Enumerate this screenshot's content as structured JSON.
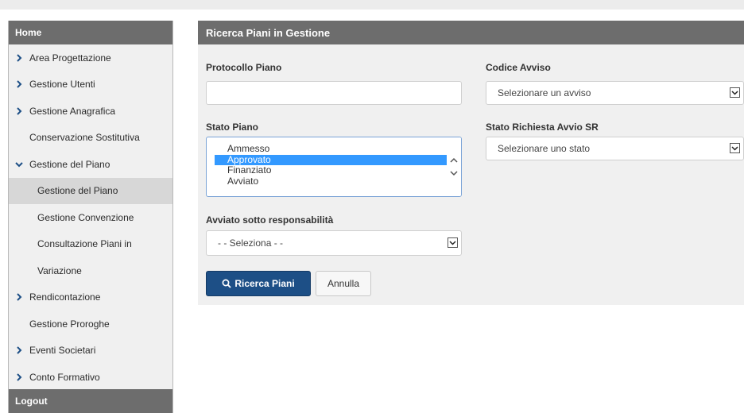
{
  "sidebar": {
    "home_label": "Home",
    "logout_label": "Logout",
    "items": [
      {
        "label": "Area Progettazione",
        "chevron": "right"
      },
      {
        "label": "Gestione Utenti",
        "chevron": "right"
      },
      {
        "label": "Gestione Anagrafica",
        "chevron": "right"
      },
      {
        "label": "Conservazione Sostitutiva",
        "chevron": "none"
      },
      {
        "label": "Gestione del Piano",
        "chevron": "down"
      },
      {
        "label": "Gestione del Piano",
        "sub": true,
        "active": true
      },
      {
        "label": "Gestione Convenzione",
        "sub": true
      },
      {
        "label": "Consultazione Piani in",
        "sub": true
      },
      {
        "label": "Variazione",
        "sub": true
      },
      {
        "label": "Rendicontazione",
        "chevron": "right"
      },
      {
        "label": "Gestione Proroghe",
        "chevron": "none"
      },
      {
        "label": "Eventi Societari",
        "chevron": "right"
      },
      {
        "label": "Conto Formativo",
        "chevron": "right"
      }
    ]
  },
  "panel": {
    "title": "Ricerca Piani in Gestione",
    "protocollo_label": "Protocollo Piano",
    "protocollo_value": "",
    "codice_label": "Codice Avviso",
    "codice_selected": "Selezionare un avviso",
    "stato_label": "Stato Piano",
    "stato_options": [
      "Ammesso",
      "Approvato",
      "Finanziato",
      "Avviato"
    ],
    "stato_selected_index": 1,
    "stato_sr_label": "Stato Richiesta Avvio SR",
    "stato_sr_selected": "Selezionare uno stato",
    "avviato_label": "Avviato sotto responsabilità",
    "avviato_selected": "- - Seleziona - -",
    "search_button": "Ricerca Piani",
    "cancel_button": "Annulla"
  },
  "colors": {
    "header_gray": "#6d6d6d",
    "panel_bg": "#f0f0f0",
    "primary_blue": "#1d4f86",
    "selection_blue": "#3399ff"
  }
}
